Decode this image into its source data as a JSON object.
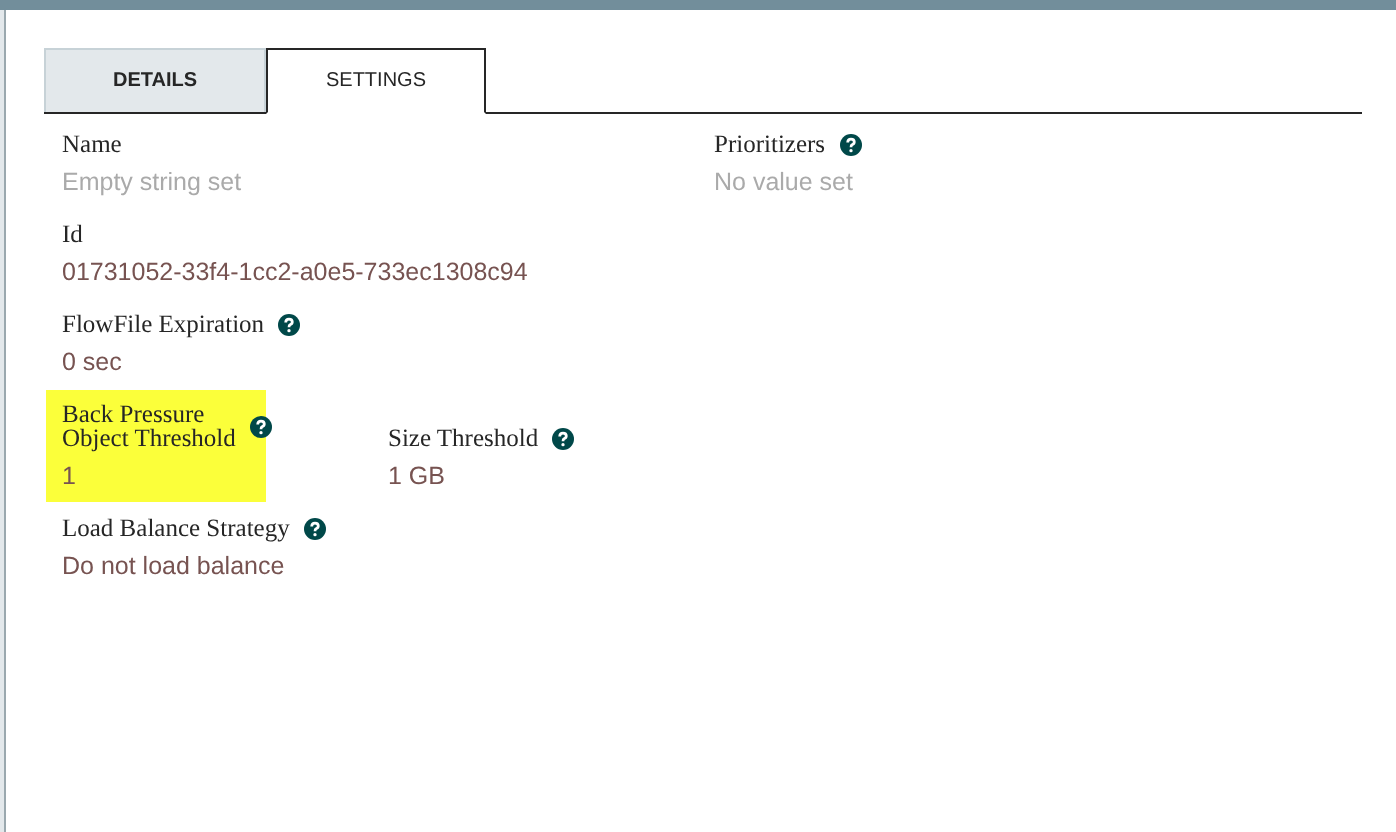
{
  "tabs": [
    {
      "label": "DETAILS",
      "selected": false
    },
    {
      "label": "SETTINGS",
      "selected": true
    }
  ],
  "left_column": [
    {
      "fields": [
        {
          "label": "Name",
          "value": "Empty string set",
          "value_set": false,
          "help": false,
          "highlighted": false
        }
      ]
    },
    {
      "fields": [
        {
          "label": "Id",
          "value": "01731052-33f4-1cc2-a0e5-733ec1308c94",
          "value_set": true,
          "help": false,
          "highlighted": false
        }
      ]
    },
    {
      "fields": [
        {
          "label": "FlowFile Expiration",
          "value": "0 sec",
          "value_set": true,
          "help": true,
          "highlighted": false
        }
      ]
    },
    {
      "fields": [
        {
          "label": "Back Pressure\nObject Threshold",
          "value": "1",
          "value_set": true,
          "help": true,
          "highlighted": true
        },
        {
          "label": "Size Threshold",
          "value": "1 GB",
          "value_set": true,
          "help": true,
          "highlighted": false
        }
      ]
    },
    {
      "fields": [
        {
          "label": "Load Balance Strategy",
          "value": "Do not load balance",
          "value_set": true,
          "help": true,
          "highlighted": false
        }
      ]
    }
  ],
  "right_column": [
    {
      "fields": [
        {
          "label": "Prioritizers",
          "value": "No value set",
          "value_set": false,
          "help": true,
          "highlighted": false
        }
      ]
    }
  ]
}
